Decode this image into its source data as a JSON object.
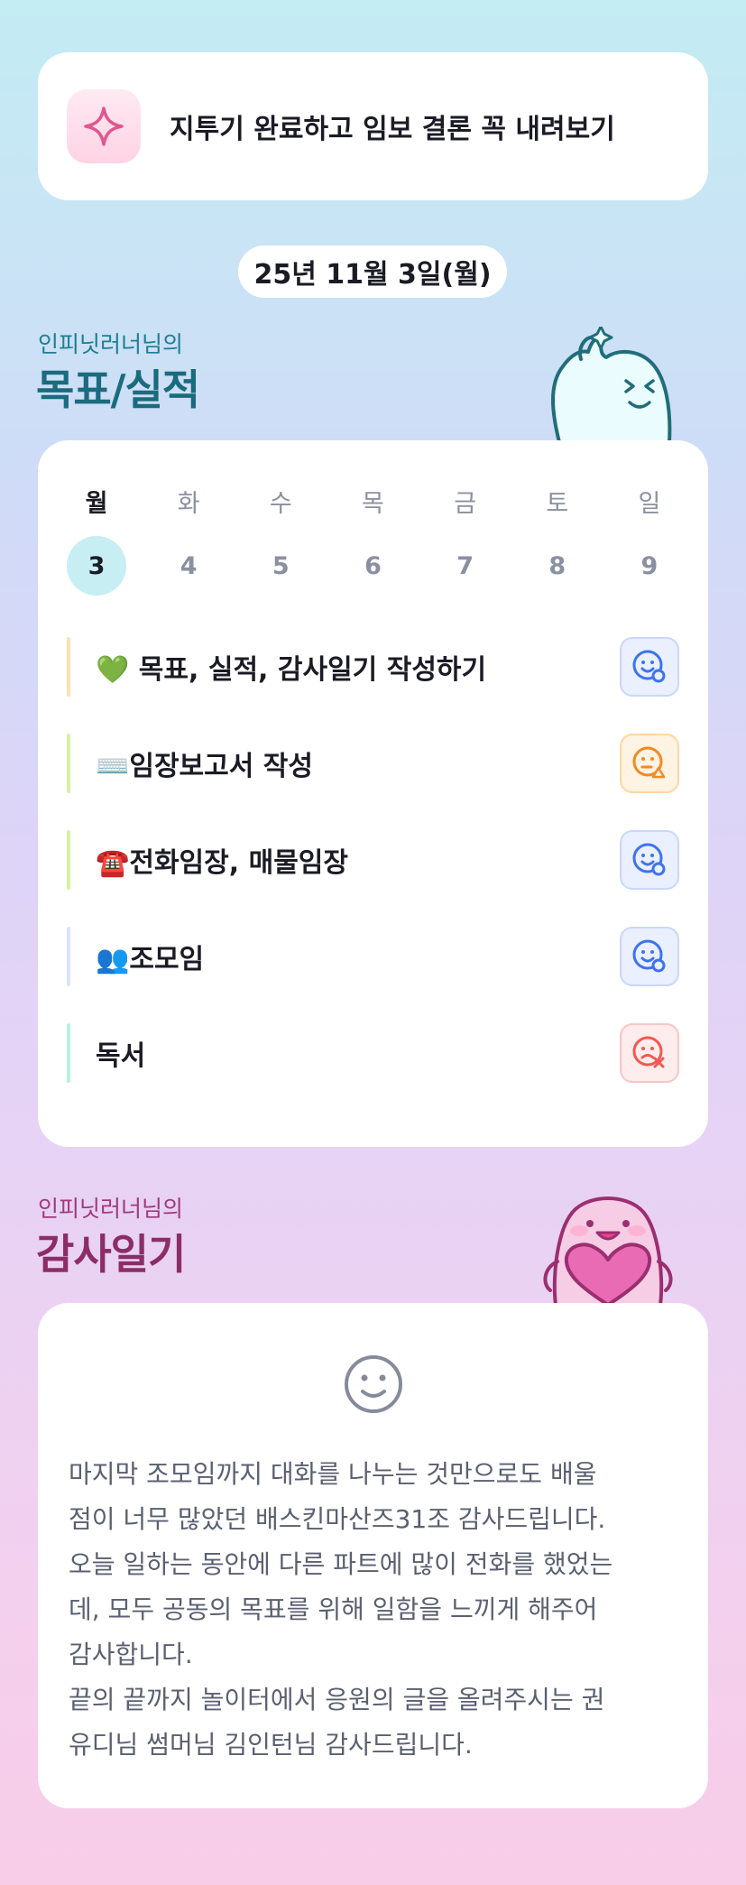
{
  "banner": {
    "icon": "sparkle-icon",
    "text": "지투기 완료하고 임보 결론 꼭 내려보기"
  },
  "date": "25년 11월 3일(월)",
  "goals_section": {
    "owner": "인피닛러너님의",
    "title": "목표/실적"
  },
  "week": {
    "days": [
      {
        "name": "월",
        "num": "3",
        "active": true
      },
      {
        "name": "화",
        "num": "4",
        "active": false
      },
      {
        "name": "수",
        "num": "5",
        "active": false
      },
      {
        "name": "목",
        "num": "6",
        "active": false
      },
      {
        "name": "금",
        "num": "7",
        "active": false
      },
      {
        "name": "토",
        "num": "8",
        "active": false
      },
      {
        "name": "일",
        "num": "9",
        "active": false
      }
    ]
  },
  "goals": [
    {
      "label": "💚 목표, 실적, 감사일기 작성하기",
      "bar_color": "#ffe0b0",
      "status": "smile-done-icon"
    },
    {
      "label": "⌨️임장보고서 작성",
      "bar_color": "#d7f0a0",
      "status": "warning-face-icon"
    },
    {
      "label": "☎️전화임장, 매물임장",
      "bar_color": "#d7f0a0",
      "status": "smile-done-icon"
    },
    {
      "label": "👥조모임",
      "bar_color": "#d8e4f8",
      "status": "smile-done-icon"
    },
    {
      "label": "독서",
      "bar_color": "#b9f0dc",
      "status": "fail-face-icon"
    }
  ],
  "diary_section": {
    "owner": "인피닛러너님의",
    "title": "감사일기"
  },
  "diary": {
    "mood_icon": "smile-icon",
    "text": "마지막 조모임까지 대화를 나누는 것만으로도 배울\n점이 너무 많았던 배스킨마산즈31조 감사드립니다.\n오늘 일하는 동안에 다른 파트에 많이 전화를 했었는\n데, 모두 공동의 목표를 위해 일함을 느끼게 해주어\n감사합니다.\n끝의 끝까지 놀이터에서 응원의 글을 올려주시는 권\n유디님 썸머님 김인턴님 감사드립니다."
  }
}
